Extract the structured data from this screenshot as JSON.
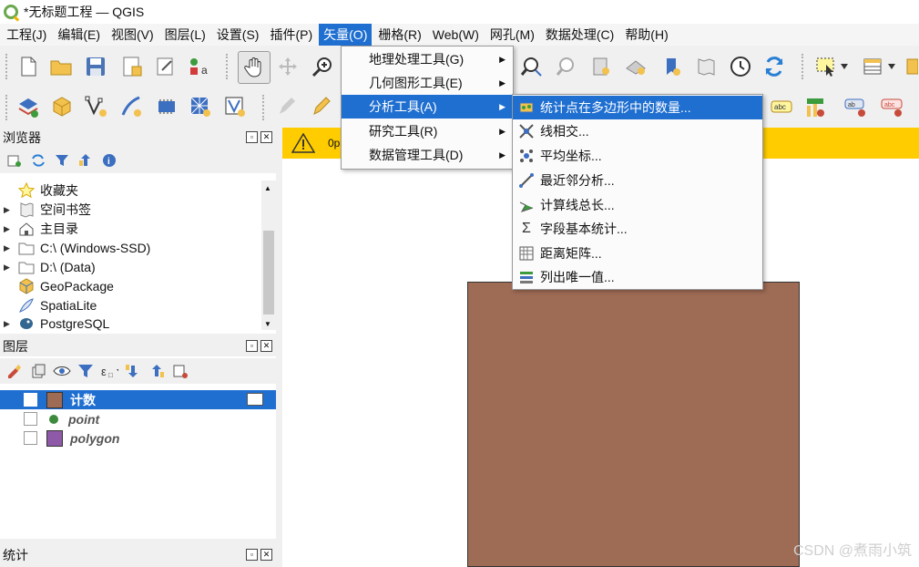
{
  "window": {
    "title": "*无标题工程 — QGIS"
  },
  "menubar": {
    "items": [
      "工程(J)",
      "编辑(E)",
      "视图(V)",
      "图层(L)",
      "设置(S)",
      "插件(P)",
      "矢量(O)",
      "栅格(R)",
      "Web(W)",
      "网孔(M)",
      "数据处理(C)",
      "帮助(H)"
    ],
    "active": "矢量(O)"
  },
  "vector_menu": {
    "items": [
      "地理处理工具(G)",
      "几何图形工具(E)",
      "分析工具(A)",
      "研究工具(R)",
      "数据管理工具(D)"
    ],
    "highlighted": "分析工具(A)"
  },
  "analysis_submenu": {
    "items": [
      {
        "label": "统计点在多边形中的数量...",
        "icon": "count-points-icon"
      },
      {
        "label": "线相交...",
        "icon": "line-intersection-icon"
      },
      {
        "label": "平均坐标...",
        "icon": "mean-coordinates-icon"
      },
      {
        "label": "最近邻分析...",
        "icon": "nearest-neighbour-icon"
      },
      {
        "label": "计算线总长...",
        "icon": "sum-line-lengths-icon"
      },
      {
        "label": "字段基本统计...",
        "icon": "sigma-icon"
      },
      {
        "label": "距离矩阵...",
        "icon": "distance-matrix-icon"
      },
      {
        "label": "列出唯一值...",
        "icon": "unique-values-icon"
      }
    ],
    "highlighted": "统计点在多边形中的数量..."
  },
  "browser_panel": {
    "title": "浏览器",
    "items": [
      {
        "label": "收藏夹",
        "icon": "star-icon"
      },
      {
        "label": "空间书签",
        "icon": "bookmark-icon"
      },
      {
        "label": "主目录",
        "icon": "home-icon"
      },
      {
        "label": "C:\\ (Windows-SSD)",
        "icon": "folder-icon"
      },
      {
        "label": "D:\\ (Data)",
        "icon": "folder-icon"
      },
      {
        "label": "GeoPackage",
        "icon": "geopackage-icon"
      },
      {
        "label": "SpatiaLite",
        "icon": "spatialite-icon"
      },
      {
        "label": "PostgreSQL",
        "icon": "postgresql-icon"
      }
    ]
  },
  "layers_panel": {
    "title": "图层",
    "layers": [
      {
        "name": "计数",
        "checked": true,
        "selected": true,
        "symbol_color": "#9e6b55"
      },
      {
        "name": "point",
        "checked": false,
        "selected": false,
        "symbol_color": "#3d8a3d"
      },
      {
        "name": "polygon",
        "checked": false,
        "selected": false,
        "symbol_color": "#8e5aa8"
      }
    ]
  },
  "stats_panel": {
    "title": "统计"
  },
  "message_bar": {
    "text": "0p"
  },
  "watermark": "CSDN @煮雨小筑",
  "colors": {
    "accent": "#1f6fd1",
    "message_bar": "#ffcc00",
    "polygon_fill": "#9e6b55"
  }
}
